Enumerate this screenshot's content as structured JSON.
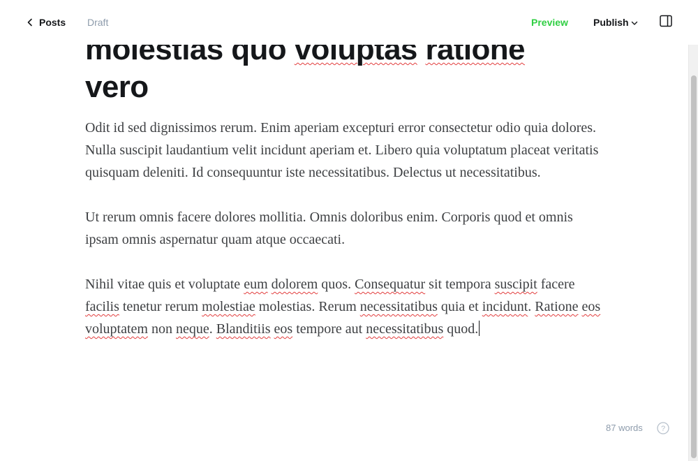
{
  "header": {
    "back_label": "Posts",
    "status": "Draft",
    "preview_label": "Preview",
    "publish_label": "Publish"
  },
  "post": {
    "title_lines": [
      "molestias quo voluptas ratione",
      "vero"
    ],
    "paragraphs": [
      [
        {
          "text": "Odit id sed dignissimos rerum. Enim aperiam excepturi error consectetur odio quia dolores. Nulla suscipit laudantium velit incidunt aperiam et. Libero quia voluptatum placeat veritatis quisquam deleniti. Id consequuntur iste necessitatibus. Delectus ut necessitatibus."
        }
      ],
      [
        {
          "text": "Ut rerum omnis facere dolores mollitia. Omnis doloribus enim. Corporis quod et omnis ipsam omnis aspernatur quam atque occaecati."
        }
      ],
      [
        {
          "text": "Nihil vitae quis et voluptate "
        },
        {
          "text": "eum",
          "misspelled": true
        },
        {
          "text": " "
        },
        {
          "text": "dolorem",
          "misspelled": true
        },
        {
          "text": " quos. "
        },
        {
          "text": "Consequatur",
          "misspelled": true
        },
        {
          "text": " sit tempora "
        },
        {
          "text": "suscipit",
          "misspelled": true
        },
        {
          "text": " facere "
        },
        {
          "text": "facilis",
          "misspelled": true
        },
        {
          "text": " tenetur rerum "
        },
        {
          "text": "molestiae",
          "misspelled": true
        },
        {
          "text": " molestias. Rerum "
        },
        {
          "text": "necessitatibus",
          "misspelled": true
        },
        {
          "text": " quia et "
        },
        {
          "text": "incidunt",
          "misspelled": true
        },
        {
          "text": ". "
        },
        {
          "text": "Ratione",
          "misspelled": true
        },
        {
          "text": " "
        },
        {
          "text": "eos",
          "misspelled": true
        },
        {
          "text": " "
        },
        {
          "text": "voluptatem",
          "misspelled": true
        },
        {
          "text": " non "
        },
        {
          "text": "neque",
          "misspelled": true
        },
        {
          "text": ". "
        },
        {
          "text": "Blanditiis",
          "misspelled": true
        },
        {
          "text": " "
        },
        {
          "text": "eos",
          "misspelled": true
        },
        {
          "text": " tempore aut "
        },
        {
          "text": "necessitatibus",
          "misspelled": true
        },
        {
          "text": " quod."
        }
      ]
    ],
    "title_misspelled": [
      "voluptas",
      "ratione"
    ]
  },
  "footer": {
    "word_count": "87 words"
  },
  "icons": {
    "back": "chevron-left-icon",
    "publish_caret": "chevron-down-icon",
    "sidebar": "sidebar-toggle-icon",
    "help": "help-circle-icon"
  },
  "colors": {
    "accent_green": "#30cf43",
    "text_dark": "#15171a",
    "text_muted": "#8e9cac",
    "spellcheck_red": "#e23d3d"
  }
}
